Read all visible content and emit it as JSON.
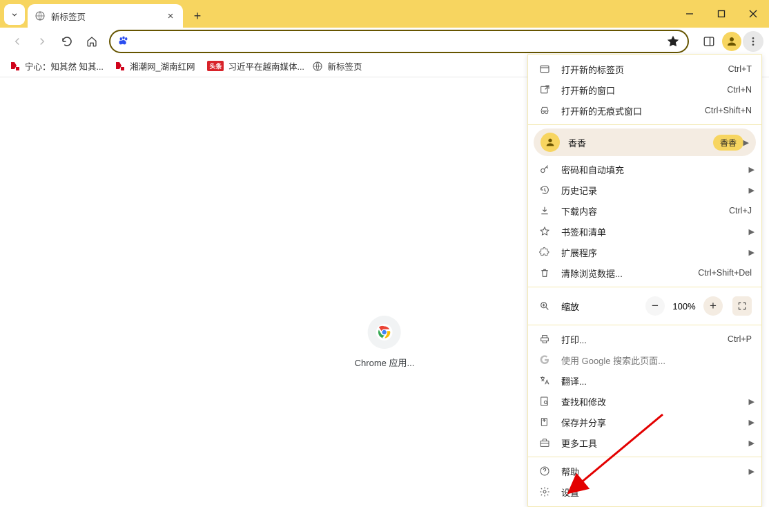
{
  "tab": {
    "title": "新标签页"
  },
  "bookmarks": [
    {
      "label": "宁心：知其然 知其...",
      "icon": "red-logo"
    },
    {
      "label": "湘潮网_湖南红网",
      "icon": "red-logo"
    },
    {
      "label": "习近平在越南媒体...",
      "icon": "badge"
    },
    {
      "label": "新标签页",
      "icon": "globe"
    }
  ],
  "ntp": {
    "label": "Chrome 应用..."
  },
  "menu": {
    "new_tab": {
      "label": "打开新的标签页",
      "shortcut": "Ctrl+T"
    },
    "new_window": {
      "label": "打开新的窗口",
      "shortcut": "Ctrl+N"
    },
    "incognito": {
      "label": "打开新的无痕式窗口",
      "shortcut": "Ctrl+Shift+N"
    },
    "profile": {
      "name": "香香",
      "badge": "香香"
    },
    "passwords": {
      "label": "密码和自动填充"
    },
    "history": {
      "label": "历史记录"
    },
    "downloads": {
      "label": "下载内容",
      "shortcut": "Ctrl+J"
    },
    "bookmarks": {
      "label": "书签和清单"
    },
    "extensions": {
      "label": "扩展程序"
    },
    "clear_data": {
      "label": "清除浏览数据...",
      "shortcut": "Ctrl+Shift+Del"
    },
    "zoom": {
      "label": "缩放",
      "value": "100%"
    },
    "print": {
      "label": "打印...",
      "shortcut": "Ctrl+P"
    },
    "google_search": {
      "label": "使用 Google 搜索此页面..."
    },
    "translate": {
      "label": "翻译..."
    },
    "find_edit": {
      "label": "查找和修改"
    },
    "save_share": {
      "label": "保存并分享"
    },
    "more_tools": {
      "label": "更多工具"
    },
    "help": {
      "label": "帮助"
    },
    "settings": {
      "label": "设置"
    }
  }
}
